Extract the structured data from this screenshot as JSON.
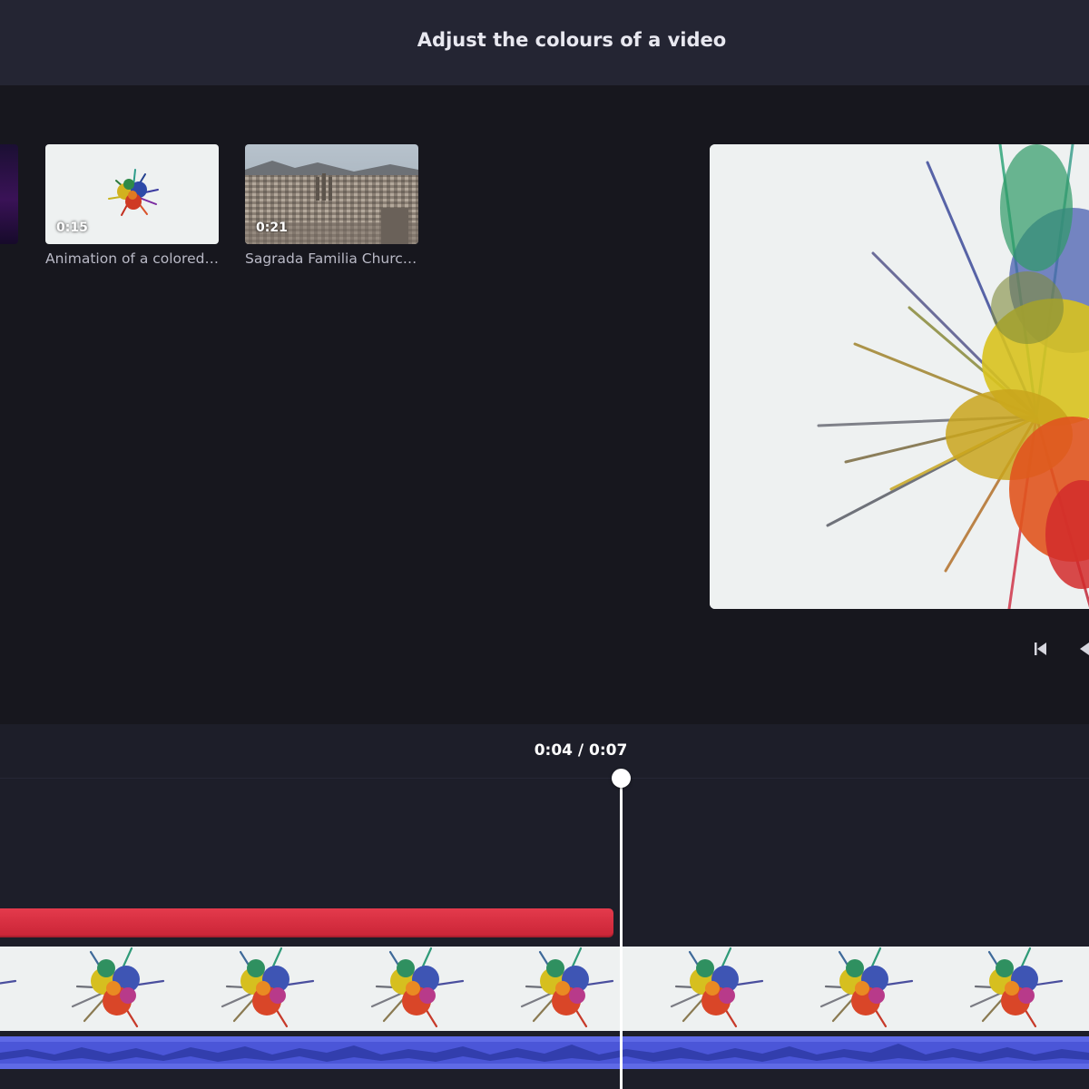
{
  "header": {
    "title": "Adjust the colours of a video"
  },
  "media": [
    {
      "duration": "0:15",
      "title": "Animation of a colored …"
    },
    {
      "duration": "0:21",
      "title": "Sagrada Familia Church…"
    }
  ],
  "timeline": {
    "time_readout": "0:04 / 0:07"
  },
  "colors": {
    "header_bg": "#242533",
    "main_bg": "#17171e",
    "timeline_bg": "#1d1e29",
    "text_track": "#d92a3e",
    "audio_track": "#4b56d8"
  }
}
